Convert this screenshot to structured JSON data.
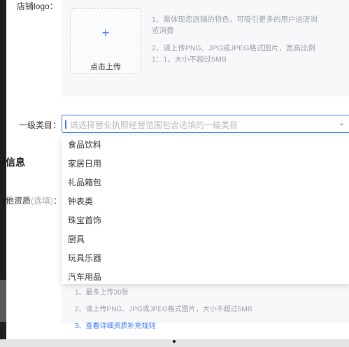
{
  "store_logo": {
    "label": "店铺logo：",
    "upload_plus": "+",
    "upload_text": "点击上传",
    "notes": [
      "1、需体现您店铺的特色，可吸引更多的用户进店浏览消费",
      "2、请上传PNG、JPG或JPEG格式图片，宽高比例1：1，大小不超过5MB"
    ]
  },
  "category": {
    "label": "一级类目：",
    "placeholder": "请选择营业执照经营范围包含选填的一级类目",
    "options": [
      "食品饮料",
      "家居日用",
      "礼品箱包",
      "钟表类",
      "珠宝首饰",
      "厨具",
      "玩具乐器",
      "汽车用品"
    ]
  },
  "section": {
    "title": "信息",
    "qualification_label": "他资质",
    "qualification_optional": "(选填)",
    "qualification_colon": "："
  },
  "qual_notes": [
    "1、最多上传30张",
    "2、请上传PNG、JPG或JPEG格式图片，大小不超过5MB"
  ],
  "qual_link": "3、查看详细资质补充规则",
  "colors": {
    "accent": "#3a7bf6",
    "panel_bg": "#f7f8fa",
    "hint": "#9aa0a8"
  },
  "icons": {
    "upload": "plus-icon",
    "dropdown": "chevron-down-icon"
  }
}
